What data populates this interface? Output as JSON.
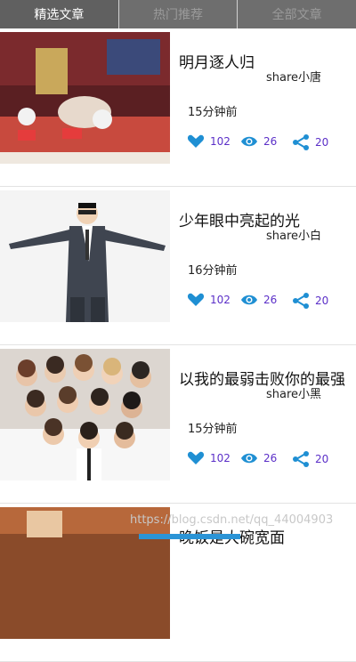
{
  "tabs": [
    {
      "label": "精选文章",
      "active": true
    },
    {
      "label": "热门推荐",
      "active": false
    },
    {
      "label": "全部文章",
      "active": false
    }
  ],
  "colors": {
    "tab_bg": "#6e6e6e",
    "accent_icon": "#1f8fd3",
    "stat_text": "#5b2fc8"
  },
  "articles": [
    {
      "title": "明月逐人归",
      "author": "share小唐",
      "time": "15分钟前",
      "likes": "102",
      "views": "26",
      "shares": "20",
      "thumbnail": "tv-show-set"
    },
    {
      "title": "少年眼中亮起的光",
      "author": "share小白",
      "time": "16分钟前",
      "likes": "102",
      "views": "26",
      "shares": "20",
      "thumbnail": "man-in-suit"
    },
    {
      "title": "以我的最弱击败你的最强",
      "author": "share小黑",
      "time": "15分钟前",
      "likes": "102",
      "views": "26",
      "shares": "20",
      "thumbnail": "group-photo"
    },
    {
      "title": "晚饭是大碗宽面",
      "thumbnail": "partial"
    }
  ],
  "watermark": "https://blog.csdn.net/qq_44004903"
}
